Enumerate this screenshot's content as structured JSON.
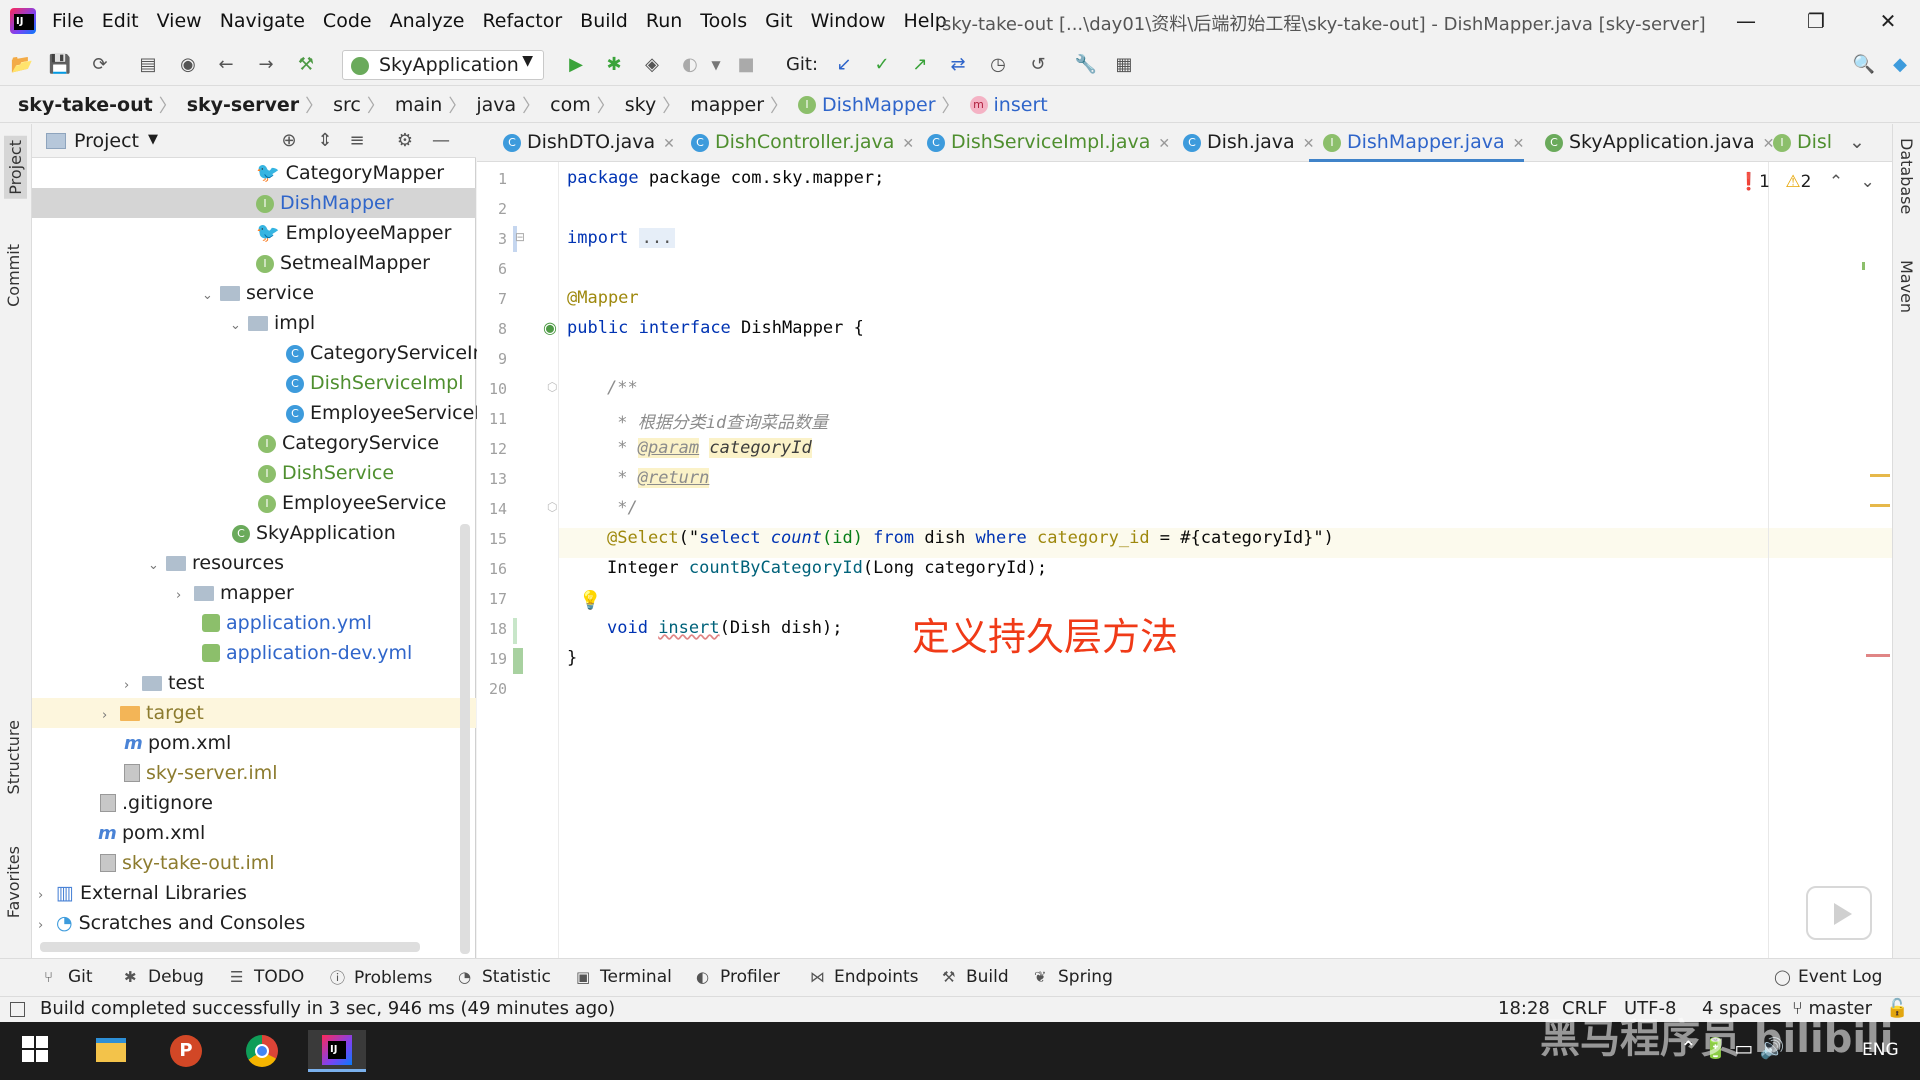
{
  "menubar": {
    "items": [
      "File",
      "Edit",
      "View",
      "Navigate",
      "Code",
      "Analyze",
      "Refactor",
      "Build",
      "Run",
      "Tools",
      "Git",
      "Window",
      "Help"
    ],
    "title": "sky-take-out [...\\day01\\资料\\后端初始工程\\sky-take-out] - DishMapper.java [sky-server]",
    "minimize": "—",
    "restore": "❐",
    "close": "✕"
  },
  "toolbar": {
    "run_config": "SkyApplication",
    "git_label": "Git:"
  },
  "breadcrumb": [
    "sky-take-out",
    "sky-server",
    "src",
    "main",
    "java",
    "com",
    "sky",
    "mapper",
    "DishMapper",
    "insert"
  ],
  "left_strip": {
    "tabs": [
      "Project",
      "Commit",
      "Structure",
      "Favorites"
    ]
  },
  "right_strip": {
    "tabs": [
      "Database",
      "Maven"
    ]
  },
  "project_panel": {
    "title": "Project",
    "tree": [
      {
        "label": "CategoryMapper",
        "color": "",
        "icon": "mybatis-bird-icon"
      },
      {
        "label": "DishMapper",
        "color": "blue",
        "icon": "interface-icon"
      },
      {
        "label": "EmployeeMapper",
        "color": "",
        "icon": "mybatis-bird-icon"
      },
      {
        "label": "SetmealMapper",
        "color": "",
        "icon": "interface-icon"
      },
      {
        "label": "service",
        "color": "",
        "icon": "folder-icon"
      },
      {
        "label": "impl",
        "color": "",
        "icon": "folder-icon"
      },
      {
        "label": "CategoryServiceIm",
        "color": "",
        "icon": "class-icon"
      },
      {
        "label": "DishServiceImpl",
        "color": "green",
        "icon": "class-icon"
      },
      {
        "label": "EmployeeServiceIm",
        "color": "",
        "icon": "class-icon"
      },
      {
        "label": "CategoryService",
        "color": "",
        "icon": "interface-icon"
      },
      {
        "label": "DishService",
        "color": "green",
        "icon": "interface-icon"
      },
      {
        "label": "EmployeeService",
        "color": "",
        "icon": "interface-icon"
      },
      {
        "label": "SkyApplication",
        "color": "",
        "icon": "spring-class-icon"
      },
      {
        "label": "resources",
        "color": "",
        "icon": "folder-icon"
      },
      {
        "label": "mapper",
        "color": "",
        "icon": "folder-icon"
      },
      {
        "label": "application.yml",
        "color": "blue",
        "icon": "yml-icon"
      },
      {
        "label": "application-dev.yml",
        "color": "blue",
        "icon": "yml-icon"
      },
      {
        "label": "test",
        "color": "",
        "icon": "folder-icon"
      },
      {
        "label": "target",
        "color": "olive",
        "icon": "folder-orange-icon"
      },
      {
        "label": "pom.xml",
        "color": "",
        "icon": "maven-icon"
      },
      {
        "label": "sky-server.iml",
        "color": "olive",
        "icon": "iml-file-icon"
      },
      {
        "label": ".gitignore",
        "color": "",
        "icon": "file-icon"
      },
      {
        "label": "pom.xml",
        "color": "",
        "icon": "maven-icon"
      },
      {
        "label": "sky-take-out.iml",
        "color": "olive",
        "icon": "iml-file-icon"
      },
      {
        "label": "External Libraries",
        "color": "",
        "icon": "library-icon"
      },
      {
        "label": "Scratches and Consoles",
        "color": "",
        "icon": "scratch-icon"
      }
    ]
  },
  "editor_tabs": [
    {
      "label": "DishDTO.java",
      "active": false
    },
    {
      "label": "DishController.java",
      "active": false
    },
    {
      "label": "DishServiceImpl.java",
      "active": false
    },
    {
      "label": "Dish.java",
      "active": false
    },
    {
      "label": "DishMapper.java",
      "active": true
    },
    {
      "label": "SkyApplication.java",
      "active": false
    },
    {
      "label": "Disl",
      "active": false
    }
  ],
  "editor": {
    "line_numbers": [
      "1",
      "2",
      "3",
      "6",
      "7",
      "8",
      "9",
      "10",
      "11",
      "12",
      "13",
      "14",
      "15",
      "16",
      "17",
      "18",
      "19",
      "20"
    ],
    "line1": "package com.sky.mapper;",
    "import_kw": "import",
    "import_dots": "...",
    "mapper_ann": "@Mapper",
    "l8_public": "public",
    "l8_interface": "interface",
    "l8_name": "DishMapper {",
    "l10": "/**",
    "l11": " * 根据分类id查询菜品数量",
    "l12_star": " * ",
    "l12_tag": "@param",
    "l12_param": "categoryId",
    "l13_star": " * ",
    "l13_tag": "@return",
    "l14": " */",
    "l15_ann": "@Select",
    "l15_open": "(\"",
    "l15_sql1": "select ",
    "l15_count": "count",
    "l15_sql2": "(id) ",
    "l15_from": "from",
    "l15_sql3": " dish ",
    "l15_where": "where",
    "l15_col": " category_id",
    "l15_rest": " = #{categoryId}",
    "l15_close": "\")",
    "l16_type": "Integer ",
    "l16_fn": "countByCategoryId",
    "l16_rest": "(Long categoryId);",
    "l18_void": "void ",
    "l18_fn": "insert",
    "l18_rest": "(Dish dish);",
    "l19": "}",
    "errors": "1",
    "warnings": "2",
    "overlay": "定义持久层方法"
  },
  "bottom_tools": [
    "Git",
    "Debug",
    "TODO",
    "Problems",
    "Statistic",
    "Terminal",
    "Profiler",
    "Endpoints",
    "Build",
    "Spring",
    "Event Log"
  ],
  "status": {
    "message": "Build completed successfully in 3 sec, 946 ms (49 minutes ago)",
    "position": "18:28",
    "line_sep": "CRLF",
    "encoding": "UTF-8",
    "indent": "4 spaces",
    "branch": "master"
  },
  "taskbar": {
    "lang": "ENG"
  },
  "watermark": "黑马程序员 bilibili"
}
